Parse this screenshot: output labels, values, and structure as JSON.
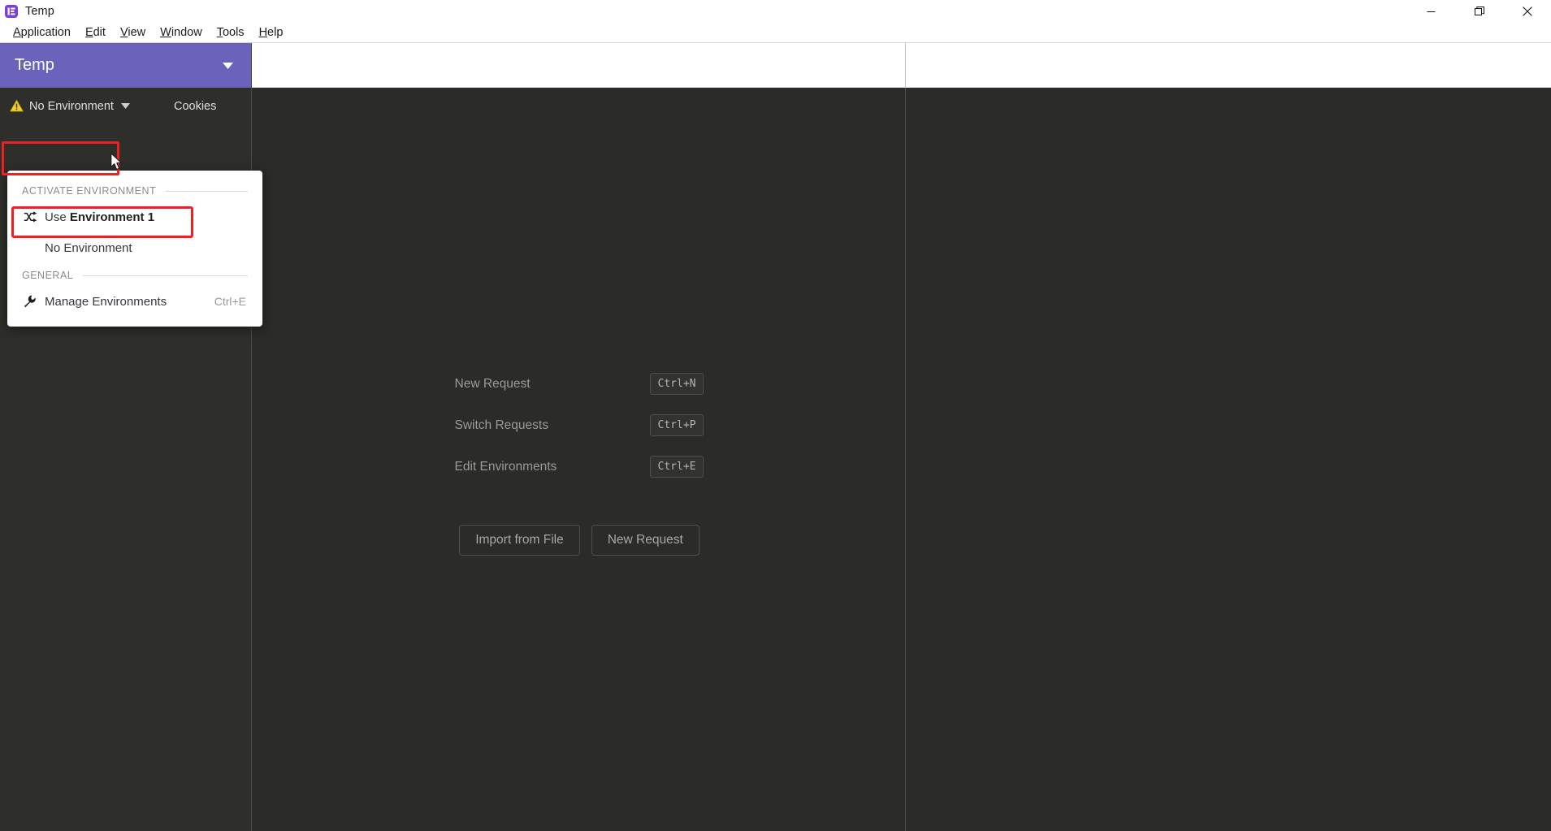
{
  "window": {
    "app_icon": "insomnia-logo-icon",
    "title": "Temp",
    "controls": {
      "minimize": "minimize-icon",
      "maximize": "restore-icon",
      "close": "close-icon"
    }
  },
  "menubar": {
    "items": [
      {
        "label": "Application",
        "accel": "A"
      },
      {
        "label": "Edit",
        "accel": "E"
      },
      {
        "label": "View",
        "accel": "V"
      },
      {
        "label": "Window",
        "accel": "W"
      },
      {
        "label": "Tools",
        "accel": "T"
      },
      {
        "label": "Help",
        "accel": "H"
      }
    ]
  },
  "sidebar": {
    "workspace": {
      "name": "Temp",
      "caret_icon": "chevron-down-icon",
      "background": "#6a62bb"
    },
    "environment_button": {
      "label": "No Environment",
      "warning_icon": "warning-triangle-icon",
      "caret_icon": "chevron-down-icon",
      "highlighted": true,
      "highlight_color": "#f02020"
    },
    "cookies_button": {
      "label": "Cookies"
    }
  },
  "dropdown": {
    "sections": [
      {
        "title": "ACTIVATE ENVIRONMENT",
        "items": [
          {
            "icon": "shuffle-icon",
            "prefix": "Use ",
            "name": "Environment 1",
            "shortcut": "",
            "highlighted": true
          },
          {
            "icon": "",
            "prefix": "",
            "name": "No Environment",
            "shortcut": "",
            "highlighted": false
          }
        ]
      },
      {
        "title": "GENERAL",
        "items": [
          {
            "icon": "wrench-icon",
            "prefix": "",
            "name": "Manage Environments",
            "shortcut": "Ctrl+E",
            "highlighted": false
          }
        ]
      }
    ]
  },
  "main": {
    "empty_state": {
      "shortcuts": [
        {
          "label": "New Request",
          "keys": "Ctrl+N"
        },
        {
          "label": "Switch Requests",
          "keys": "Ctrl+P"
        },
        {
          "label": "Edit Environments",
          "keys": "Ctrl+E"
        }
      ],
      "buttons": [
        {
          "label": "Import from File"
        },
        {
          "label": "New Request"
        }
      ]
    }
  },
  "cursor": {
    "type": "arrow-cursor"
  }
}
